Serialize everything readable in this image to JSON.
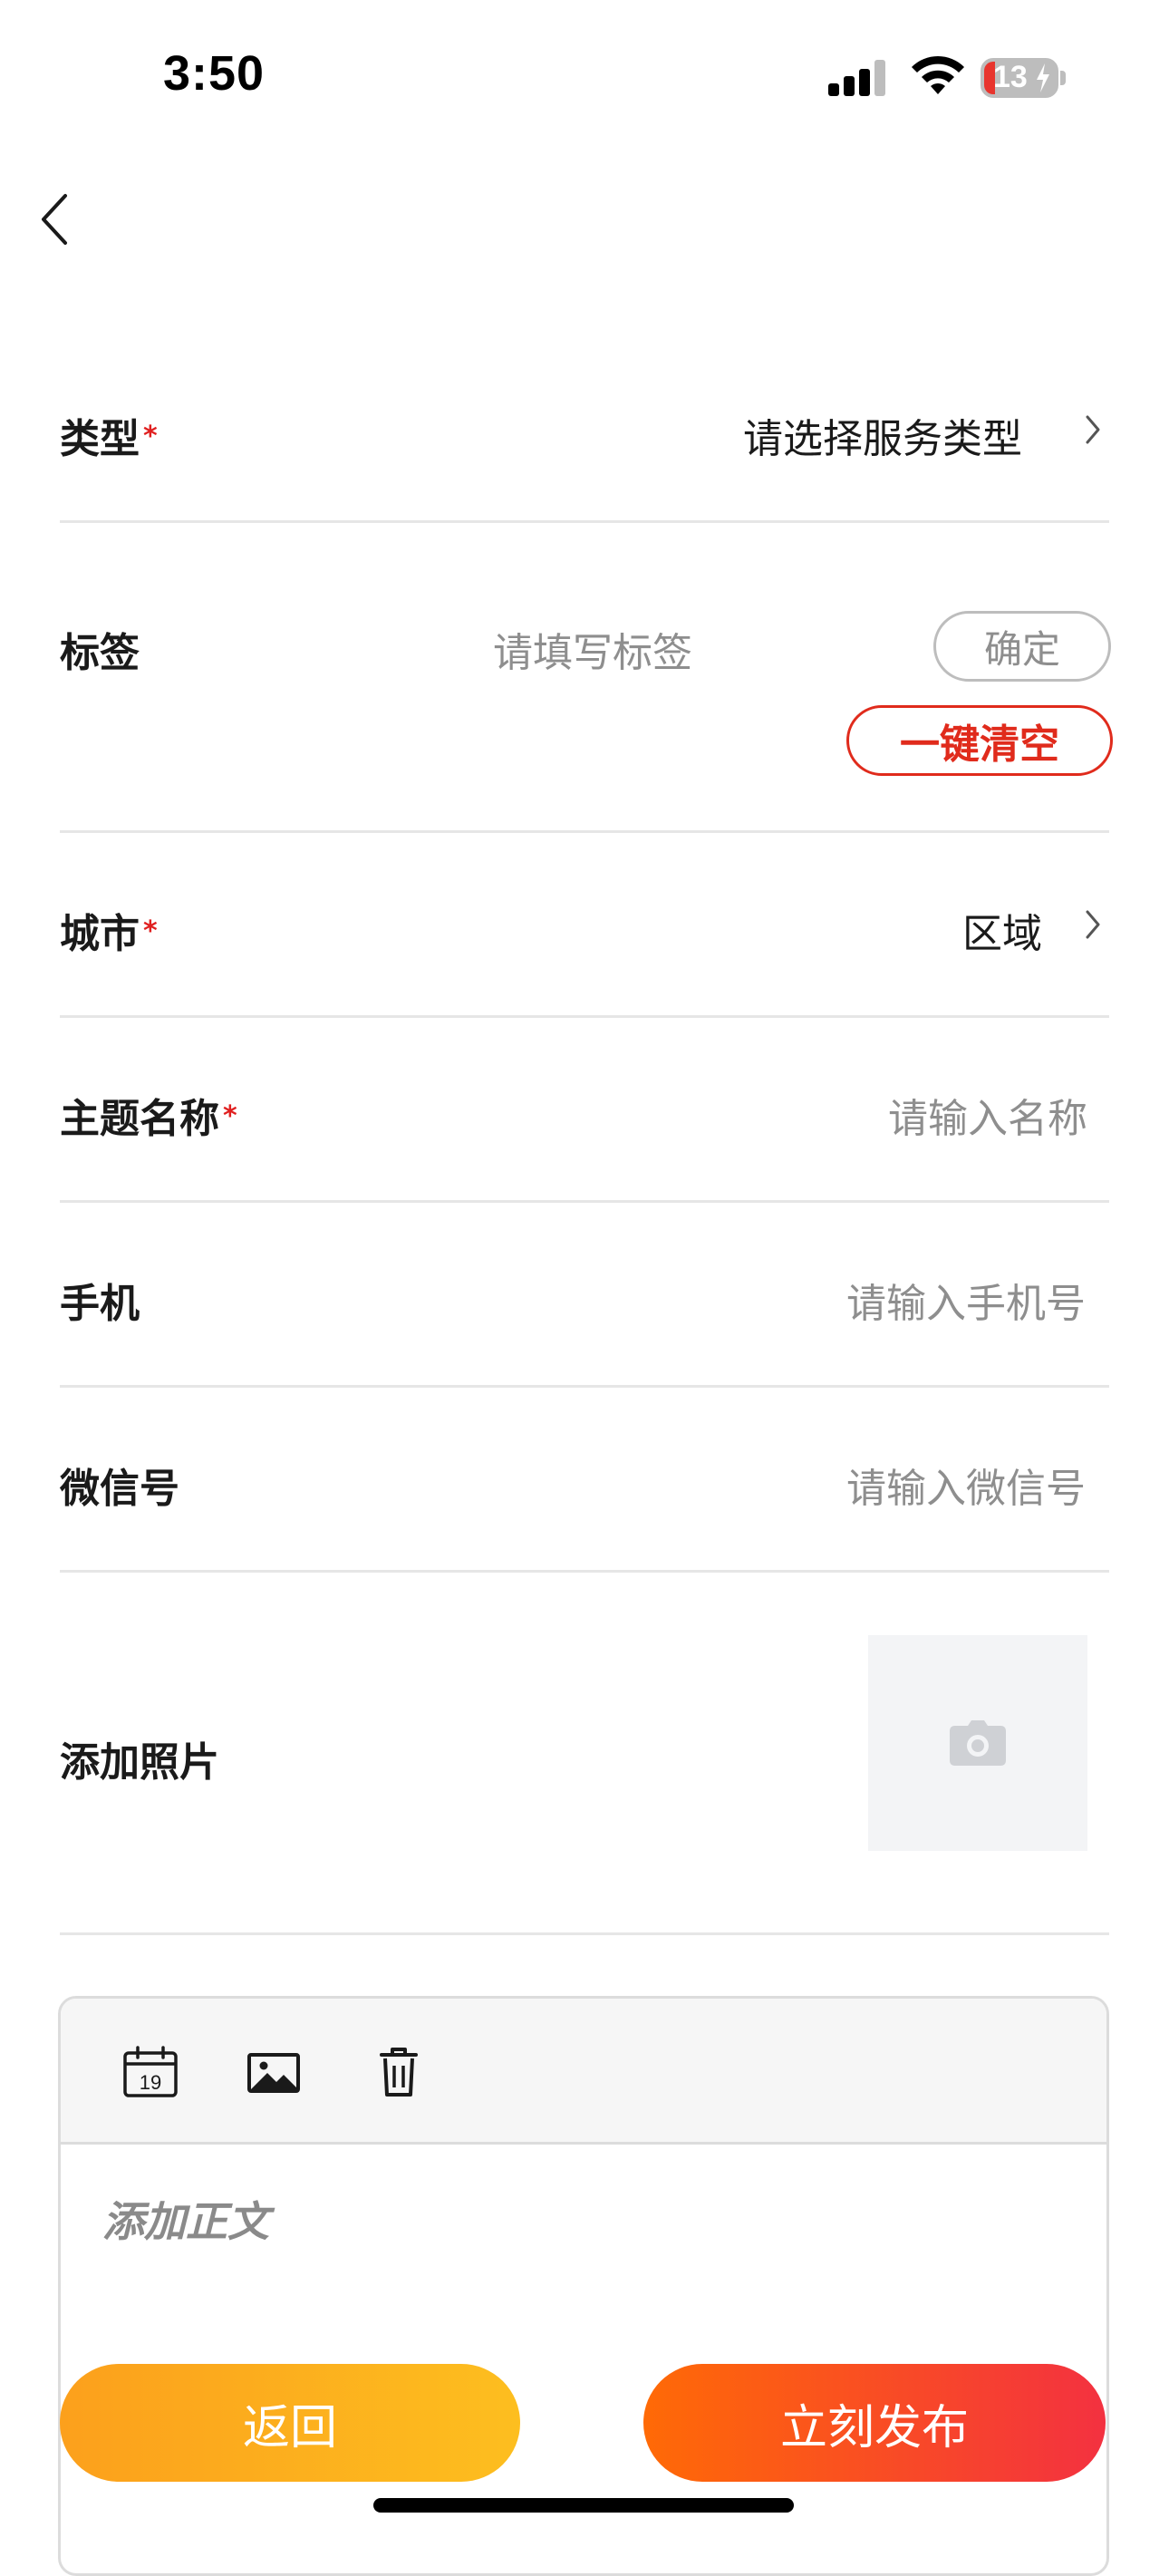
{
  "status_bar": {
    "time": "3:50",
    "battery": "13"
  },
  "nav": {
    "back_icon": "chevron-left-icon"
  },
  "form": {
    "type": {
      "label": "类型",
      "required": "*",
      "value": "请选择服务类型"
    },
    "tags": {
      "label": "标签",
      "placeholder": "请填写标签",
      "confirm_label": "确定",
      "clear_label": "一键清空"
    },
    "city": {
      "label": "城市",
      "required": "*",
      "value": "区域"
    },
    "subject": {
      "label": "主题名称",
      "required": "*",
      "placeholder": "请输入名称"
    },
    "phone": {
      "label": "手机",
      "placeholder": "请输入手机号"
    },
    "wechat": {
      "label": "微信号",
      "placeholder": "请输入微信号"
    },
    "photo": {
      "label": "添加照片",
      "icon": "camera-icon"
    }
  },
  "editor": {
    "tools": [
      "calendar-icon",
      "image-icon",
      "trash-icon"
    ],
    "calendar_day": "19",
    "placeholder": "添加正文"
  },
  "actions": {
    "back_label": "返回",
    "publish_label": "立刻发布"
  },
  "colors": {
    "required": "#e02020",
    "clear_button": "#e02b1c",
    "back_button": "#fca01c",
    "publish_button": "#ff6a06"
  }
}
